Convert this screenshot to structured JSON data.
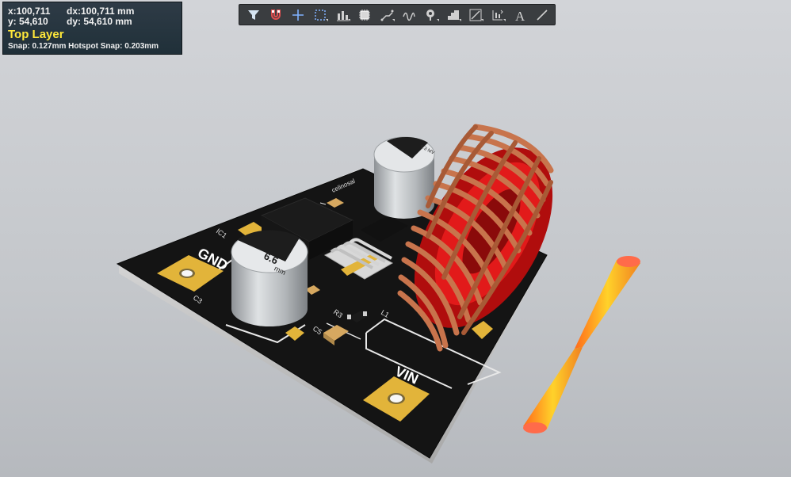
{
  "info": {
    "x": "x:100,711",
    "dx": "dx:100,711 mm",
    "y": "y: 54,610",
    "dy": "dy: 54,610  mm",
    "layer": "Top Layer",
    "snap": "Snap: 0.127mm Hotspot Snap: 0.203mm"
  },
  "toolbar": {
    "items": [
      {
        "name": "filter-icon"
      },
      {
        "name": "snap-magnet-icon"
      },
      {
        "name": "crosshair-icon"
      },
      {
        "name": "select-rect-icon"
      },
      {
        "name": "align-icon"
      },
      {
        "name": "component-icon"
      },
      {
        "name": "route-icon"
      },
      {
        "name": "interactive-route-icon"
      },
      {
        "name": "pad-icon"
      },
      {
        "name": "polygon-icon"
      },
      {
        "name": "dimension-icon"
      },
      {
        "name": "measure-icon"
      },
      {
        "name": "text-icon"
      },
      {
        "name": "line-icon"
      }
    ],
    "text_glyph": "A"
  },
  "board": {
    "silk": {
      "gnd": "GND",
      "vin": "VIN",
      "ic1": "IC1",
      "c3": "C3",
      "c5": "C5",
      "r3": "R3",
      "l1": "L1",
      "label_top": "celinosal",
      "cap_big_value": "6.6",
      "cap_big_unit": "mm",
      "cap_small_value": "6.3 MV"
    },
    "colors": {
      "board": "#141414",
      "pad": "#e2b43a",
      "copper_coil": "#c8744c",
      "core": "#d81818",
      "capacitor": "#b6babd"
    }
  }
}
